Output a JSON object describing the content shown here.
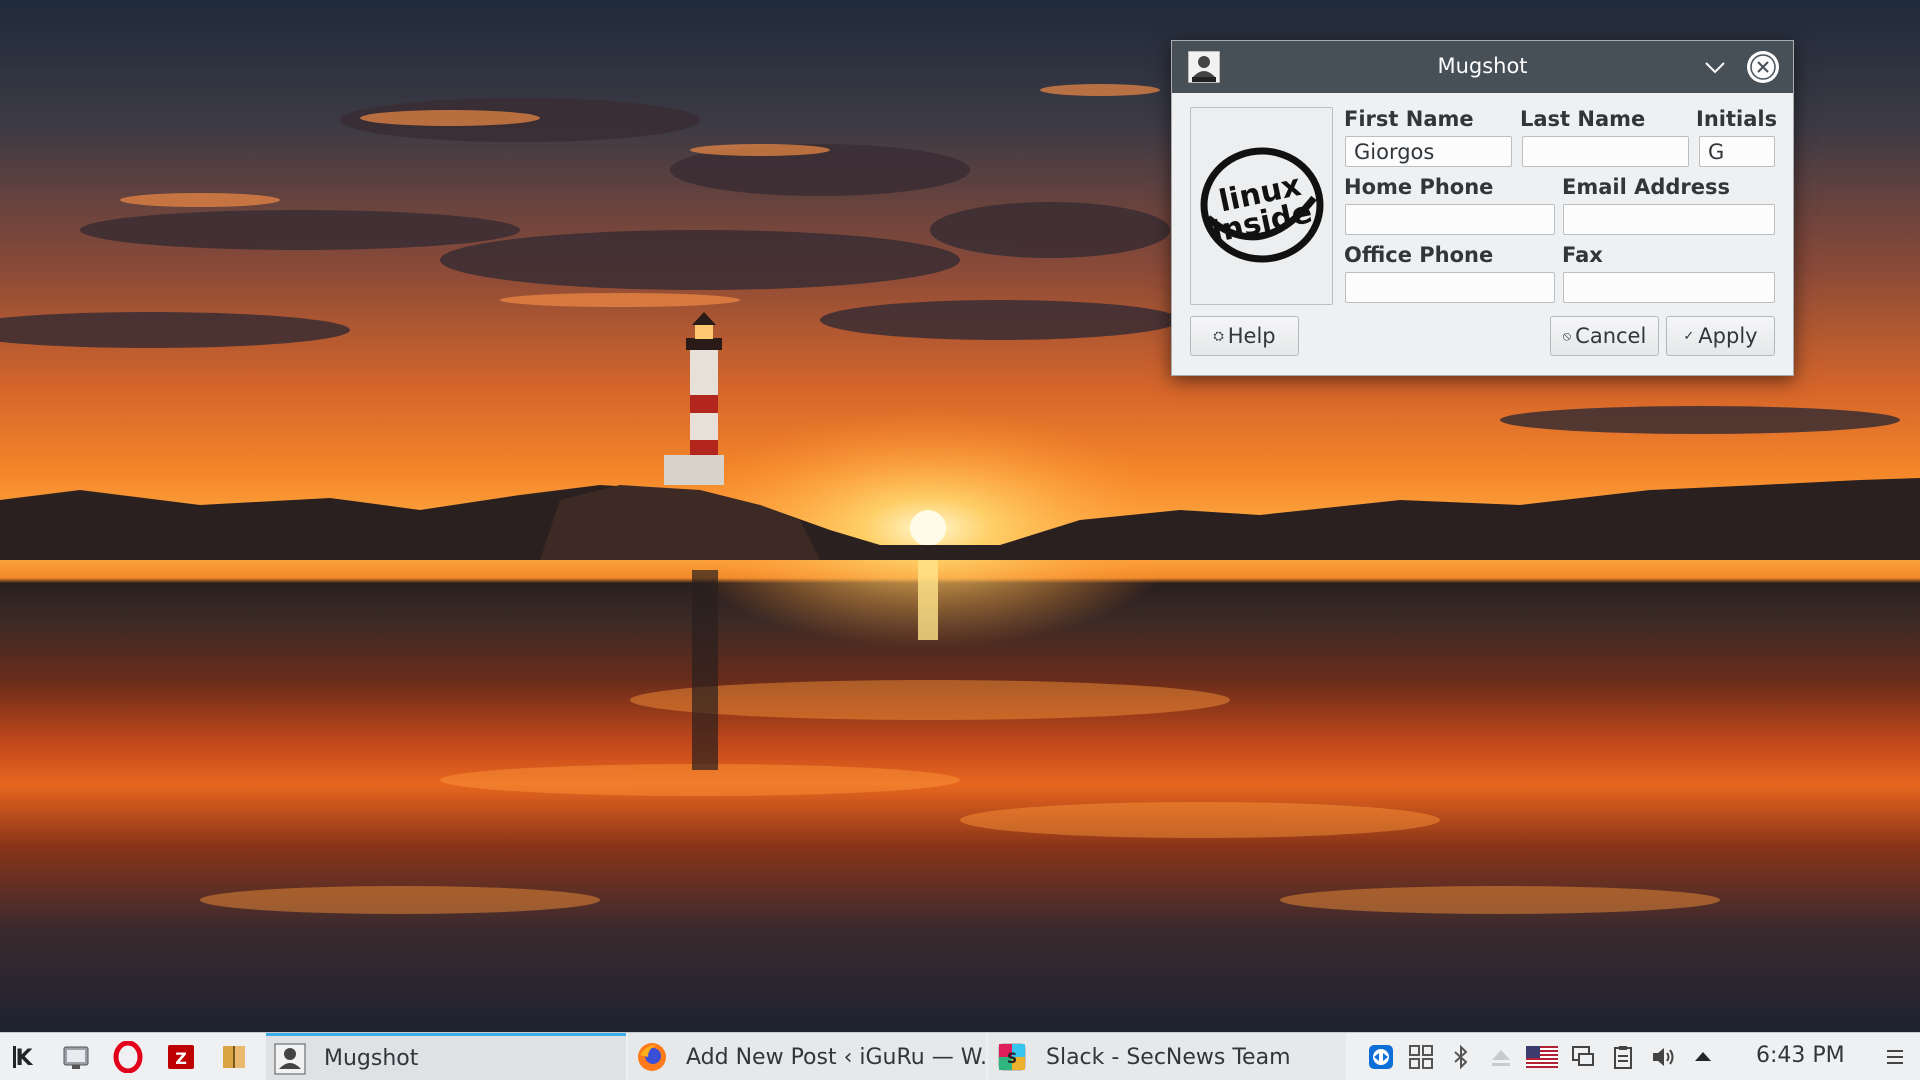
{
  "dialog": {
    "title": "Mugshot",
    "fields": {
      "first_name": {
        "label": "First Name",
        "value": "Giorgos"
      },
      "last_name": {
        "label": "Last Name",
        "value": ""
      },
      "initials": {
        "label": "Initials",
        "value": "G"
      },
      "home_phone": {
        "label": "Home Phone",
        "value": ""
      },
      "email": {
        "label": "Email Address",
        "value": ""
      },
      "office_phone": {
        "label": "Office Phone",
        "value": ""
      },
      "fax": {
        "label": "Fax",
        "value": ""
      }
    },
    "logo_text": [
      "linux",
      "inside"
    ],
    "buttons": {
      "help": "Help",
      "cancel": "Cancel",
      "apply": "Apply"
    }
  },
  "taskbar": {
    "tasks": [
      {
        "label": "Mugshot",
        "icon": "mugshot-icon",
        "active": true
      },
      {
        "label": "Add New Post ‹ iGuRu — W...",
        "icon": "firefox-icon"
      },
      {
        "label": "Slack - SecNews Team",
        "icon": "slack-icon"
      }
    ],
    "launchers": [
      "kde-menu-icon",
      "system-monitor-icon",
      "opera-icon",
      "filezilla-icon",
      "book-reader-icon"
    ],
    "tray": [
      "teamviewer-icon",
      "network-icon",
      "bluetooth-icon",
      "eject-icon",
      "us-flag-icon",
      "display-icon",
      "clipboard-icon",
      "volume-icon",
      "expand-tray-icon"
    ],
    "clock": "6:43 PM"
  },
  "colors": {
    "titlebar": "#475057",
    "dialog_bg": "#eff0f1",
    "accent": "#3daee9",
    "taskbar_bg": "#eff0f1"
  }
}
